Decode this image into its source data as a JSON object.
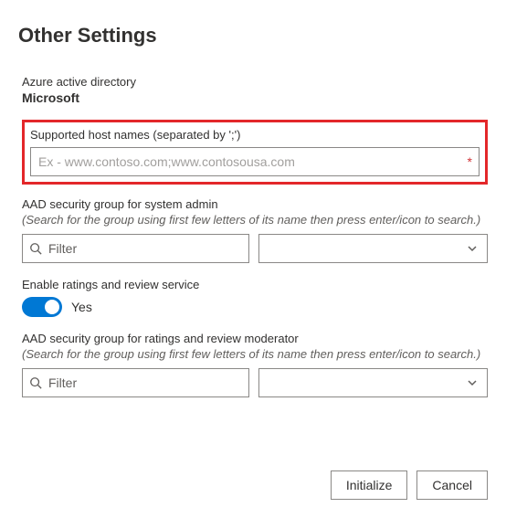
{
  "title": "Other Settings",
  "aad": {
    "small_label": "Azure active directory",
    "name": "Microsoft"
  },
  "hostnames": {
    "label": "Supported host names (separated by ';')",
    "placeholder": "Ex - www.contoso.com;www.contosousa.com",
    "value": "",
    "required_mark": "*"
  },
  "sys_admin_group": {
    "label": "AAD security group for system admin",
    "hint": "(Search for the group using first few letters of its name then press enter/icon to search.)",
    "filter_placeholder": "Filter",
    "filter_value": "",
    "selected": ""
  },
  "ratings": {
    "label": "Enable ratings and review service",
    "value": true,
    "text": "Yes"
  },
  "moderator_group": {
    "label": "AAD security group for ratings and review moderator",
    "hint": "(Search for the group using first few letters of its name then press enter/icon to search.)",
    "filter_placeholder": "Filter",
    "filter_value": "",
    "selected": ""
  },
  "buttons": {
    "initialize": "Initialize",
    "cancel": "Cancel"
  }
}
